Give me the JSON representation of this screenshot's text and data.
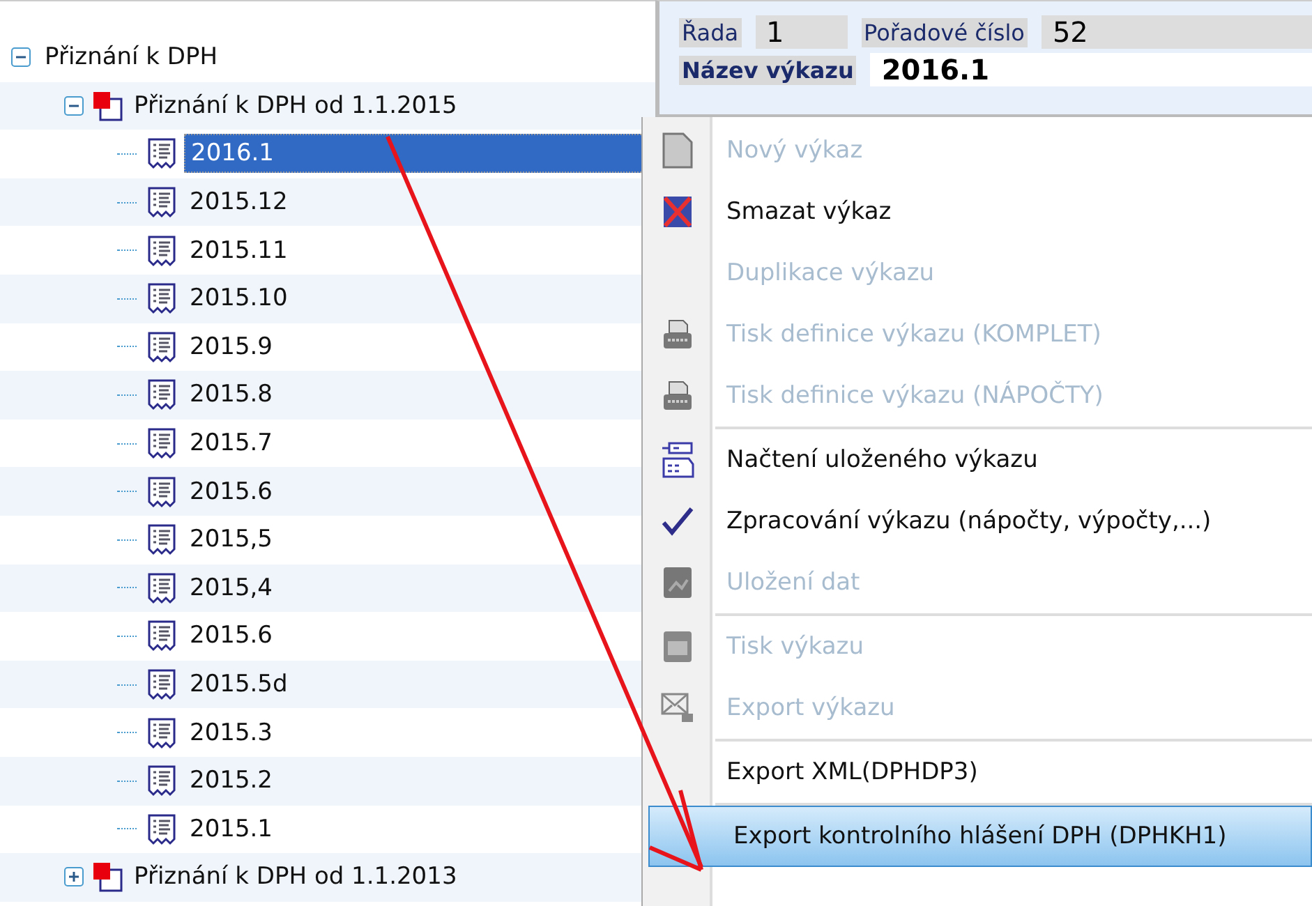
{
  "tree": [
    {
      "label": "Přiznání k DPH",
      "expanded": true,
      "selected": false,
      "children": [
        {
          "label": "Přiznání k DPH od 1.1.2015",
          "kind": "folder",
          "expanded": true,
          "selected": false,
          "children": [
            {
              "label": "2016.1",
              "kind": "report",
              "selected": true
            },
            {
              "label": "2015.12",
              "kind": "report",
              "selected": false
            },
            {
              "label": "2015.11",
              "kind": "report",
              "selected": false
            },
            {
              "label": "2015.10",
              "kind": "report",
              "selected": false
            },
            {
              "label": "2015.9",
              "kind": "report",
              "selected": false
            },
            {
              "label": "2015.8",
              "kind": "report",
              "selected": false
            },
            {
              "label": "2015.7",
              "kind": "report",
              "selected": false
            },
            {
              "label": "2015.6",
              "kind": "report",
              "selected": false
            },
            {
              "label": "2015,5",
              "kind": "report",
              "selected": false
            },
            {
              "label": "2015,4",
              "kind": "report",
              "selected": false
            },
            {
              "label": "2015.6",
              "kind": "report",
              "selected": false
            },
            {
              "label": "2015.5d",
              "kind": "report",
              "selected": false
            },
            {
              "label": "2015.3",
              "kind": "report",
              "selected": false
            },
            {
              "label": "2015.2",
              "kind": "report",
              "selected": false
            },
            {
              "label": "2015.1",
              "kind": "report",
              "selected": false
            }
          ]
        },
        {
          "label": "Přiznání k DPH od 1.1.2013",
          "kind": "folder",
          "expanded": false,
          "selected": false
        }
      ]
    }
  ],
  "header": {
    "series_label": "Řada",
    "series_value": "1",
    "number_label": "Pořadové číslo",
    "number_value": "52",
    "name_label": "Název výkazu",
    "name_value": "2016.1"
  },
  "menu": [
    {
      "label": "Nový výkaz",
      "kind": "page",
      "disabled": true,
      "separator_above": false,
      "selected": false
    },
    {
      "label": "Smazat výkaz",
      "kind": "delete",
      "disabled": false,
      "separator_above": false,
      "selected": false
    },
    {
      "label": "Duplikace výkazu",
      "kind": "plain",
      "disabled": true,
      "separator_above": false,
      "selected": false
    },
    {
      "label": "Tisk definice výkazu (KOMPLET)",
      "kind": "print",
      "disabled": true,
      "separator_above": false,
      "selected": false
    },
    {
      "label": "Tisk definice výkazu (NÁPOČTY)",
      "kind": "print",
      "disabled": true,
      "separator_above": false,
      "selected": false
    },
    {
      "label": "Načtení uloženého výkazu",
      "kind": "load",
      "disabled": false,
      "separator_above": true,
      "selected": false
    },
    {
      "label": "Zpracování výkazu (nápočty, výpočty,...)",
      "kind": "process",
      "disabled": false,
      "separator_above": false,
      "selected": false
    },
    {
      "label": "Uložení dat",
      "kind": "save",
      "disabled": true,
      "separator_above": false,
      "selected": false
    },
    {
      "label": "Tisk výkazu",
      "kind": "sheet",
      "disabled": true,
      "separator_above": true,
      "selected": false
    },
    {
      "label": "Export výkazu",
      "kind": "export",
      "disabled": true,
      "separator_above": false,
      "selected": false
    },
    {
      "label": "Export XML(DPHDP3)",
      "kind": "plain",
      "disabled": false,
      "separator_above": true,
      "selected": false
    },
    {
      "label": "Export kontrolního hlášení DPH (DPHKH1)",
      "kind": "plain",
      "disabled": false,
      "separator_above": true,
      "selected": true
    }
  ]
}
